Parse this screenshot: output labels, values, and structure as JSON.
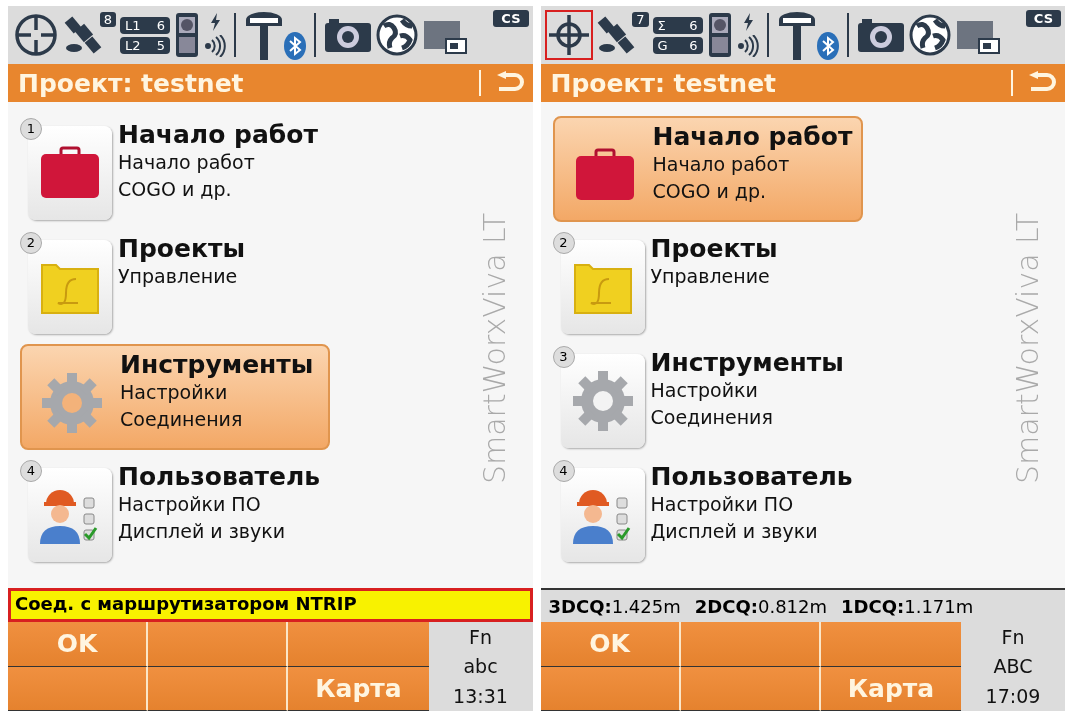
{
  "panels": [
    {
      "crosshair_selected": false,
      "satellites": "8",
      "badges": [
        {
          "label": "L1",
          "value": "6"
        },
        {
          "label": "L2",
          "value": "5"
        }
      ],
      "battery": "CS",
      "title": "Проект: testnet",
      "brand": "SmartWorxViva LT",
      "menu": [
        {
          "number": "1",
          "title": "Начало работ",
          "lines": [
            "Начало работ",
            "COGO и др."
          ],
          "kind": "case",
          "selected": false
        },
        {
          "number": "2",
          "title": "Проекты",
          "lines": [
            "Управление"
          ],
          "kind": "folder",
          "selected": false
        },
        {
          "title": "Инструменты",
          "lines": [
            "Настройки",
            "Соединения"
          ],
          "kind": "gear",
          "selected": true
        },
        {
          "number": "4",
          "title": "Пользователь",
          "lines": [
            "Настройки ПО",
            "Дисплей и звуки"
          ],
          "kind": "user",
          "selected": false
        }
      ],
      "status_line": {
        "kind": "message",
        "text": "Соед. с маршрутизатором NTRIP"
      },
      "softkeys": {
        "top_left": "OK",
        "bottom_right": "Карта"
      },
      "fn": [
        "Fn",
        "abc",
        "13:31"
      ]
    },
    {
      "crosshair_selected": true,
      "satellites": "7",
      "badges": [
        {
          "label": "Σ",
          "value": "6"
        },
        {
          "label": "G",
          "value": "6"
        }
      ],
      "battery": "CS",
      "title": "Проект: testnet",
      "brand": "SmartWorxViva LT",
      "menu": [
        {
          "title": "Начало работ",
          "lines": [
            "Начало работ",
            "COGO и др."
          ],
          "kind": "case",
          "selected": true
        },
        {
          "number": "2",
          "title": "Проекты",
          "lines": [
            "Управление"
          ],
          "kind": "folder",
          "selected": false
        },
        {
          "number": "3",
          "title": "Инструменты",
          "lines": [
            "Настройки",
            "Соединения"
          ],
          "kind": "gear",
          "selected": false
        },
        {
          "number": "4",
          "title": "Пользователь",
          "lines": [
            "Настройки ПО",
            "Дисплей и звуки"
          ],
          "kind": "user",
          "selected": false
        }
      ],
      "status_line": {
        "kind": "quality",
        "items": [
          {
            "label": "3DCQ:",
            "value": "1.425m"
          },
          {
            "label": "2DCQ:",
            "value": "0.812m"
          },
          {
            "label": "1DCQ:",
            "value": "1.171m"
          }
        ]
      },
      "softkeys": {
        "top_left": "OK",
        "bottom_right": "Карта"
      },
      "fn": [
        "Fn",
        "ABC",
        "17:09"
      ]
    }
  ]
}
